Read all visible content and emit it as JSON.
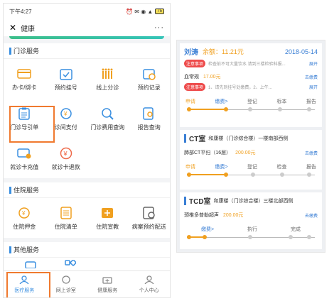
{
  "status_bar": {
    "time": "下午4:27",
    "signal_icons": "⏰ ✉ ◉ ▲",
    "battery": "75"
  },
  "nav": {
    "title": "健康",
    "more": "···"
  },
  "sections": [
    {
      "title": "门诊服务",
      "items": [
        {
          "label": "办卡/绑卡",
          "icon": "card-icon"
        },
        {
          "label": "预约挂号",
          "icon": "calendar-check-icon"
        },
        {
          "label": "线上分诊",
          "icon": "queue-icon"
        },
        {
          "label": "预约记录",
          "icon": "record-icon"
        },
        {
          "label": "门诊导引单",
          "icon": "clipboard-icon"
        },
        {
          "label": "诊间支付",
          "icon": "pay-icon"
        },
        {
          "label": "门诊费用查询",
          "icon": "fee-search-icon"
        },
        {
          "label": "报告查询",
          "icon": "report-search-icon"
        },
        {
          "label": "就诊卡充值",
          "icon": "card-recharge-icon"
        },
        {
          "label": "就诊卡退款",
          "icon": "refund-icon"
        }
      ]
    },
    {
      "title": "住院服务",
      "items": [
        {
          "label": "住院押金",
          "icon": "deposit-icon"
        },
        {
          "label": "住院清单",
          "icon": "list-icon"
        },
        {
          "label": "住院宣教",
          "icon": "education-icon"
        },
        {
          "label": "病案预约配送",
          "icon": "delivery-icon"
        }
      ]
    },
    {
      "title": "其他服务",
      "items": []
    }
  ],
  "tabbar": [
    {
      "label": "医疗服务",
      "icon": "medical-icon",
      "active": true
    },
    {
      "label": "网上诊室",
      "icon": "chat-icon",
      "active": false
    },
    {
      "label": "健康服务",
      "icon": "health-icon",
      "active": false
    },
    {
      "label": "个人中心",
      "icon": "person-icon",
      "active": false
    }
  ],
  "guide": {
    "patient": "刘涛",
    "balance": "余额：11.21元",
    "date": "2018-05-14",
    "notice_tag": "注意事项",
    "notice_text_1": "检查前不可大量饮水 请到三楼检验科报...",
    "expand": "展开",
    "item1_name": "血常规",
    "item1_price": "17.00元",
    "pay_label": "去缴费",
    "notice_text_2": "1、请先到挂号处缴费，2、上午...",
    "steps1": [
      "申请",
      "缴费>",
      "登记",
      "标本",
      "报告"
    ],
    "ct_title": "CT室",
    "ct_loc": "和康楼（门诊综合楼）一楼南部西侧",
    "ct_item": "肺部CT平扫（16层）",
    "ct_price": "200.00元",
    "steps2": [
      "申请",
      "缴费>",
      "登记",
      "检查",
      "报告"
    ],
    "tcd_title": "TCD室",
    "tcd_loc": "和康楼（门诊综合楼）三楼北部西侧",
    "tcd_item": "颈椎多普勒超声",
    "tcd_price": "200.00元",
    "steps3": [
      "缴费>",
      "执行",
      "完成"
    ]
  },
  "colors": {
    "accent": "#3a8fe0",
    "highlight": "#f07a2f",
    "money": "#f0a020"
  }
}
